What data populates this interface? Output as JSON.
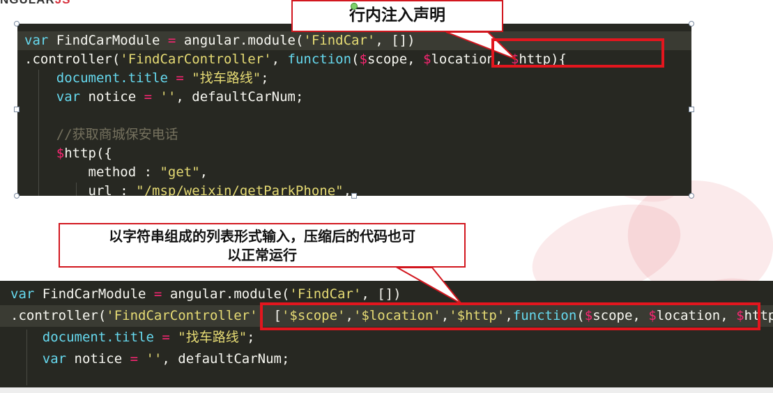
{
  "logo": {
    "prefix": "NGULAR",
    "suffix": "JS"
  },
  "callout_top": "行内注入声明",
  "callout_middle_lines": [
    "以字符串组成的列表形式输入，压缩后的代码也可",
    "以正常运行"
  ],
  "code_top": {
    "line1": {
      "var": "var",
      "name": " FindCarModule ",
      "eq": "=",
      "call": " angular.module(",
      "str": "'FindCar'",
      "rest": ", [])"
    },
    "line2": {
      "pre": ".controller(",
      "str": "'FindCarController'",
      "sep": ", ",
      "fn": "function",
      "open": "(",
      "d1": "$",
      "p1": "scope, ",
      "d2": "$",
      "p2": "location, ",
      "d3": "$",
      "p3": "http){"
    },
    "line3": {
      "ind": "    ",
      "kw": "document.title",
      "eq": " = ",
      "str": "\"找车路线\"",
      "end": ";"
    },
    "line4": {
      "ind": "    ",
      "var": "var",
      "rest": " notice ",
      "eq": "=",
      "str": " ''",
      "end": ", defaultCarNum;"
    },
    "line5": "",
    "line6": {
      "ind": "    ",
      "cm": "//获取商城保安电话"
    },
    "line7": {
      "ind": "    ",
      "d": "$",
      "rest": "http({"
    },
    "line8": {
      "ind": "        ",
      "key": "method : ",
      "str": "\"get\"",
      "end": ","
    },
    "line9": {
      "ind": "        ",
      "key": "url : ",
      "str": "\"/msp/weixin/getParkPhone\"",
      "end": ","
    }
  },
  "code_bottom": {
    "line1": {
      "var": "var",
      "name": " FindCarModule ",
      "eq": "=",
      "call": " angular.module(",
      "str": "'FindCar'",
      "rest": ", [])"
    },
    "line2": {
      "pre": ".controller(",
      "str": "'FindCarController'",
      "sep": ", ",
      "br": "[",
      "s1": "'$scope'",
      "c1": ",",
      "s2": "'$location'",
      "c2": ",",
      "s3": "'$http'",
      "c3": ",",
      "fn": "function",
      "open": "(",
      "d1": "$",
      "p1": "scope, ",
      "d2": "$",
      "p2": "location, ",
      "d3": "$",
      "p3": "http){"
    },
    "line3": {
      "ind": "    ",
      "kw": "document.title",
      "eq": " = ",
      "str": "\"找车路线\"",
      "end": ";"
    },
    "line4": {
      "ind": "    ",
      "var": "var",
      "rest": " notice ",
      "eq": "=",
      "str": " ''",
      "end": ", defaultCarNum;"
    }
  },
  "colors": {
    "keyword": "#66d9ef",
    "string": "#e6db74",
    "operator": "#f92672",
    "comment": "#75715e",
    "highlight": "#e3161e",
    "background": "#272822"
  }
}
